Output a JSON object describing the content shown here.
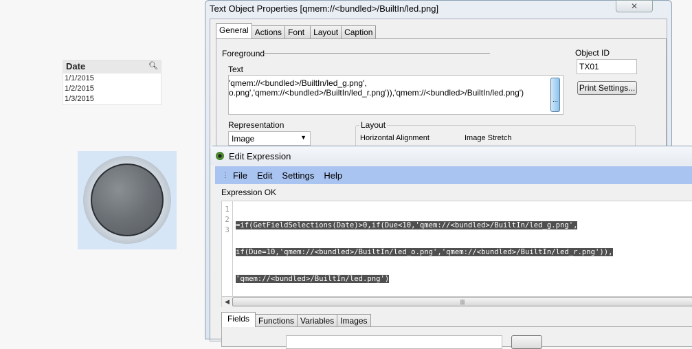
{
  "listbox": {
    "title": "Date",
    "search_icon": "magnifier-icon",
    "values": [
      "1/1/2015",
      "1/2/2015",
      "1/3/2015"
    ]
  },
  "led": {
    "icon": "led-gray-icon"
  },
  "text_object_properties": {
    "title": "Text Object Properties [qmem://<bundled>/BuiltIn/led.png]",
    "close_label": "✕",
    "tabs": [
      "General",
      "Actions",
      "Font",
      "Layout",
      "Caption"
    ],
    "active_tab": "General",
    "foreground_label": "Foreground",
    "text_label": "Text",
    "text_lines": [
      "'qmem://<bundled>/BuiltIn/led_g.png',",
      "o.png','qmem://<bundled>/BuiltIn/led_r.png')),'qmem://<bundled>/BuiltIn/led.png')"
    ],
    "ellipsis_label": "...",
    "object_id_label": "Object ID",
    "object_id_value": "TX01",
    "print_settings_label": "Print Settings...",
    "representation_label": "Representation",
    "representation_value": "Image",
    "layout_label": "Layout",
    "horizontal_alignment_label": "Horizontal Alignment",
    "image_stretch_label": "Image Stretch"
  },
  "edit_expression": {
    "title": "Edit Expression",
    "menu": [
      "File",
      "Edit",
      "Settings",
      "Help"
    ],
    "status": "Expression OK",
    "line_numbers": [
      "1",
      "2",
      "3"
    ],
    "code_lines": [
      "=if(GetFieldSelections(Date)>0,if(Due<10,'qmem://<bundled>/BuiltIn/led_g.png',",
      "if(Due=10,'qmem://<bundled>/BuiltIn/led_o.png','qmem://<bundled>/BuiltIn/led_r.png')),",
      "'qmem://<bundled>/BuiltIn/led.png')"
    ],
    "tabs": [
      "Fields",
      "Functions",
      "Variables",
      "Images"
    ],
    "active_tab": "Fields"
  }
}
